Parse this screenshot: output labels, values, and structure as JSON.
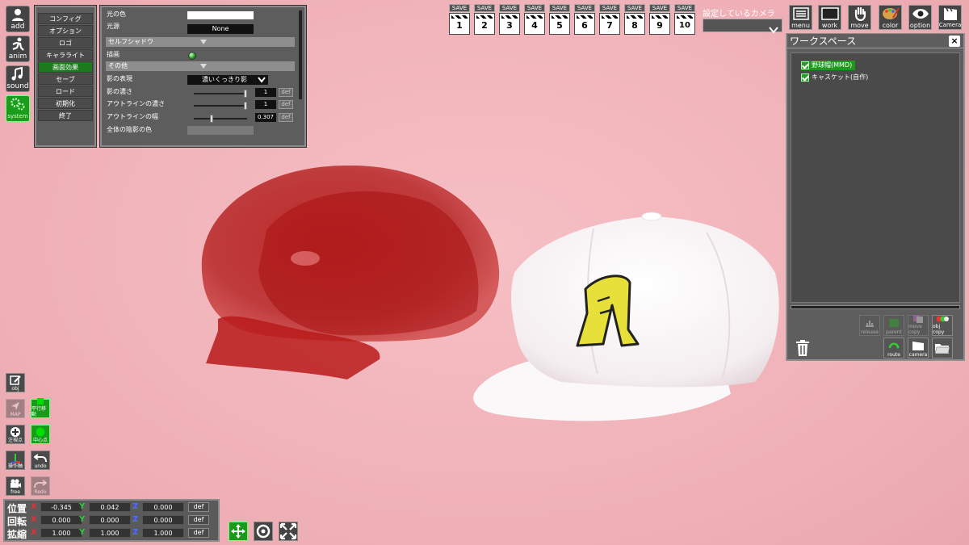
{
  "left_toolbar": {
    "add": "add",
    "anim": "anim",
    "sound": "sound",
    "system": "system"
  },
  "system_menu": [
    "コンフィグ",
    "オプション",
    "ロゴ",
    "キャラライト",
    "画面効果",
    "セーブ",
    "ロード",
    "初期化",
    "終了"
  ],
  "system_menu_active_index": 4,
  "settings": {
    "light_color_label": "光の色",
    "light_source_label": "光源",
    "light_source_value": "None",
    "self_shadow_section": "セルフシャドウ",
    "draw_label": "描画",
    "other_section": "その他",
    "shadow_expr_label": "影の表現",
    "shadow_expr_value": "濃いくっきり影",
    "shadow_density_label": "影の濃さ",
    "shadow_density_value": "1",
    "outline_density_label": "アウトラインの濃さ",
    "outline_density_value": "1",
    "outline_width_label": "アウトラインの幅",
    "outline_width_value": "0.307",
    "global_shade_label": "全体の陰影の色",
    "def": "def"
  },
  "save_slots": {
    "label": "SAVE",
    "numbers": [
      "1",
      "2",
      "3",
      "4",
      "5",
      "6",
      "7",
      "8",
      "9",
      "10"
    ]
  },
  "camera": {
    "label": "設定しているカメラ",
    "value": ""
  },
  "top_right_buttons": [
    "menu",
    "work",
    "move",
    "color",
    "option",
    "Camera"
  ],
  "workspace": {
    "title": "ワークスペース",
    "close": "×",
    "items": [
      "野球帽(MMD)",
      "キャスケット(自作)"
    ],
    "buttons": {
      "release": "release",
      "parent": "parent",
      "move_copy": "move copy",
      "obj_copy": "obj copy",
      "route": "route",
      "camera": "camera"
    }
  },
  "bottom_tools": {
    "obj": "obj",
    "map": "MAP",
    "parallel_move": "平行移動",
    "gaze": "注視点",
    "center": "中心点",
    "axis": "操作軸",
    "undo": "undo",
    "free": "free",
    "redo": "Redo"
  },
  "transform": {
    "rows": [
      {
        "label": "位置",
        "x": "-0.345",
        "y": "0.042",
        "z": "0.000"
      },
      {
        "label": "回転",
        "x": "0.000",
        "y": "0.000",
        "z": "0.000"
      },
      {
        "label": "拡縮",
        "x": "1.000",
        "y": "1.000",
        "z": "1.000"
      }
    ],
    "axis_x": "X",
    "axis_y": "Y",
    "axis_z": "Z",
    "def": "def"
  },
  "colors": {
    "background": "#efb1b7",
    "accent_green": "#1c9c1c",
    "axis_x": "#e0303a",
    "axis_y": "#39c639",
    "axis_z": "#4a6cff"
  }
}
